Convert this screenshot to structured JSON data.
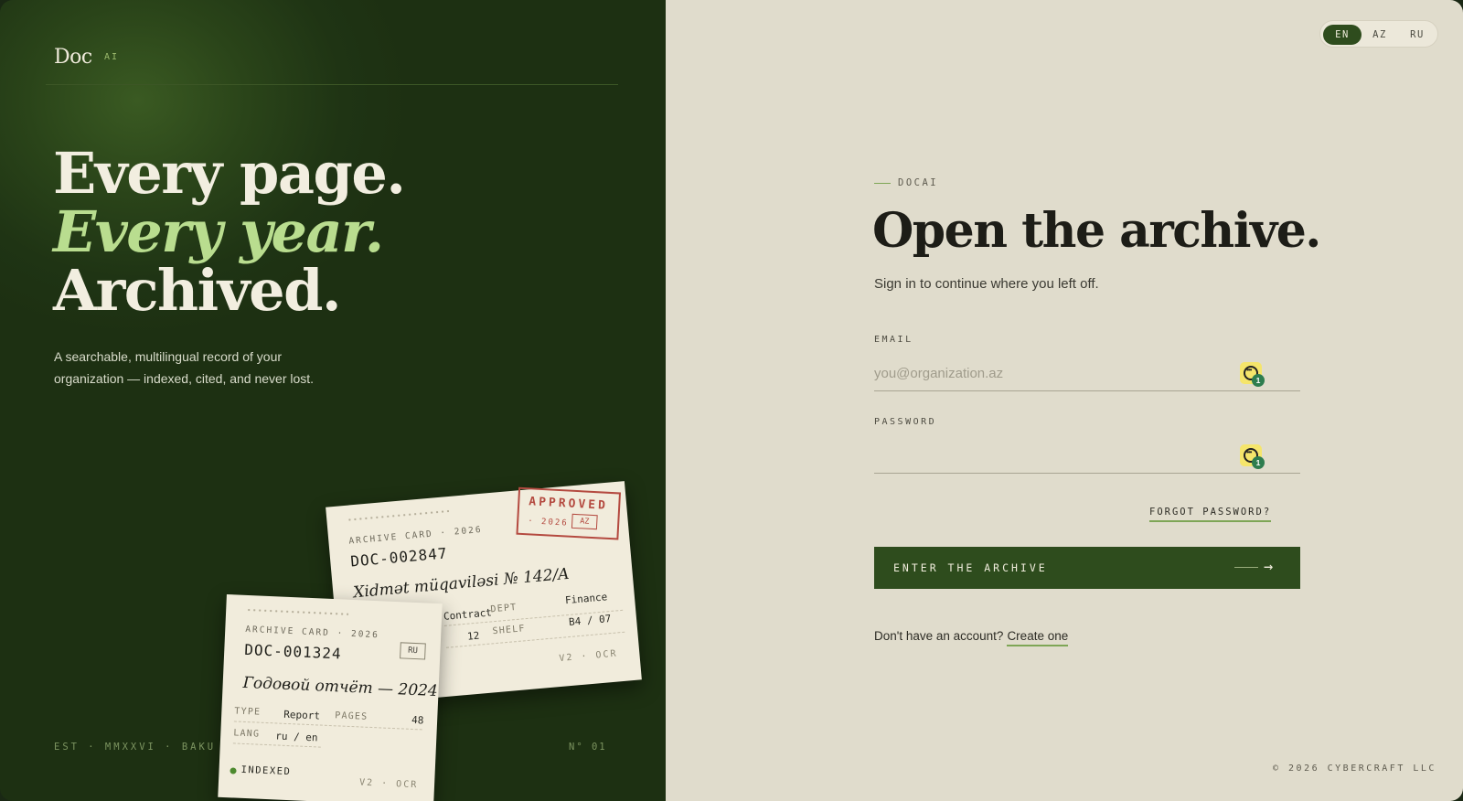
{
  "brand": {
    "name": "Doc",
    "suffix": "AI"
  },
  "hero": {
    "line1": "Every page.",
    "line2": "Every year.",
    "line3": "Archived.",
    "tagline": "A searchable, multilingual record of your organization — indexed, cited, and never lost."
  },
  "footer_left": {
    "est": "EST · MMXXVI · BAKU",
    "number": "N° 01"
  },
  "card_back": {
    "kicker": "ARCHIVE CARD · 2026",
    "doc_id": "DOC-002847",
    "title": "Xidmət müqaviləsi № 142/A",
    "type_value": "Contract",
    "pages_value": "12",
    "dept_label": "DEPT",
    "dept_value": "Finance",
    "shelf_label": "SHELF",
    "shelf_value": "B4 / 07",
    "version": "V2 · OCR",
    "stamp_text": "APPROVED",
    "stamp_year": "· 2026",
    "stamp_lang": "AZ"
  },
  "card_front": {
    "kicker": "ARCHIVE CARD · 2026",
    "lang_badge": "RU",
    "doc_id": "DOC-001324",
    "title": "Годовой отчёт — 2024",
    "type_label": "TYPE",
    "type_value": "Report",
    "pages_label": "PAGES",
    "pages_value": "48",
    "lang_label": "LANG",
    "lang_value": "ru / en",
    "status": "INDEXED",
    "version": "V2 · OCR"
  },
  "language_toggle": {
    "options": [
      "EN",
      "AZ",
      "RU"
    ],
    "selected": "EN"
  },
  "login": {
    "kicker": "DOCAI",
    "title": "Open the archive.",
    "subtitle": "Sign in to continue where you left off.",
    "email_label": "EMAIL",
    "email_placeholder": "you@organization.az",
    "email_value": "",
    "password_label": "PASSWORD",
    "password_value": "",
    "password_manager_badge": "1",
    "forgot_label": "FORGOT PASSWORD?",
    "submit_label": "ENTER THE ARCHIVE",
    "submit_arrow": "→",
    "signup_prompt": "Don't have an account?",
    "signup_link": "Create one"
  },
  "copyright": "© 2026 CYBERCRAFT LLC",
  "colors": {
    "panel_green": "#1f3414",
    "accent_green": "#2e4c1d",
    "highlight_green": "#b9dd8f",
    "paper": "#e0dccc",
    "stamp_red": "#b44a40"
  }
}
